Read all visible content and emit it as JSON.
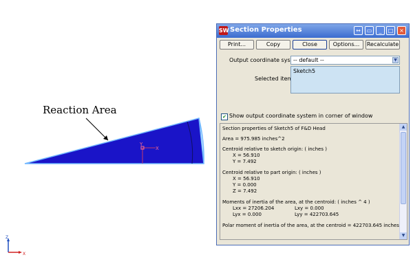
{
  "annotation": {
    "label": "Reaction Area"
  },
  "triad": {
    "z_label": "Z",
    "x_label": "X"
  },
  "sketch_triad": {
    "y_label": "Y",
    "x_label": "X"
  },
  "dialog": {
    "title": "Section Properties",
    "buttons": {
      "print": "Print...",
      "copy": "Copy",
      "close": "Close",
      "options": "Options...",
      "recalculate": "Recalculate"
    },
    "output_coord_label": "Output coordinate system:",
    "output_coord_value": "-- default --",
    "selected_items_label": "Selected items:",
    "selected_items": [
      "Sketch5"
    ],
    "show_checkbox_label": "Show output coordinate system in corner of window",
    "show_checkbox_checked": true,
    "results": {
      "header": "Section properties of Sketch5 of F&D Head",
      "area": "Area = 975.985 inches^2",
      "centroid_sketch_title": "Centroid relative to sketch origin: ( inches )",
      "centroid_sketch_x": "X = 56.910",
      "centroid_sketch_y": "Y = 7.492",
      "centroid_part_title": "Centroid relative to part origin: ( inches )",
      "centroid_part_x": "X = 56.910",
      "centroid_part_y": "Y = 0.000",
      "centroid_part_z": "Z = 7.492",
      "moments_title": "Moments of inertia of the area, at the centroid: ( inches ^ 4 )",
      "lxx": "Lxx = 27206.204",
      "lxy": "Lxy = 0.000",
      "lyx": "Lyx = 0.000",
      "lyy": "Lyy = 422703.645",
      "polar": "Polar moment of inertia of the area, at the centroid = 422703.645 inches ^ 4"
    }
  },
  "colors": {
    "section_fill": "#1a14c8",
    "section_edge": "#6fb6ff",
    "titlebar": "#3b6ccf",
    "dialog_bg": "#eae6d8"
  }
}
